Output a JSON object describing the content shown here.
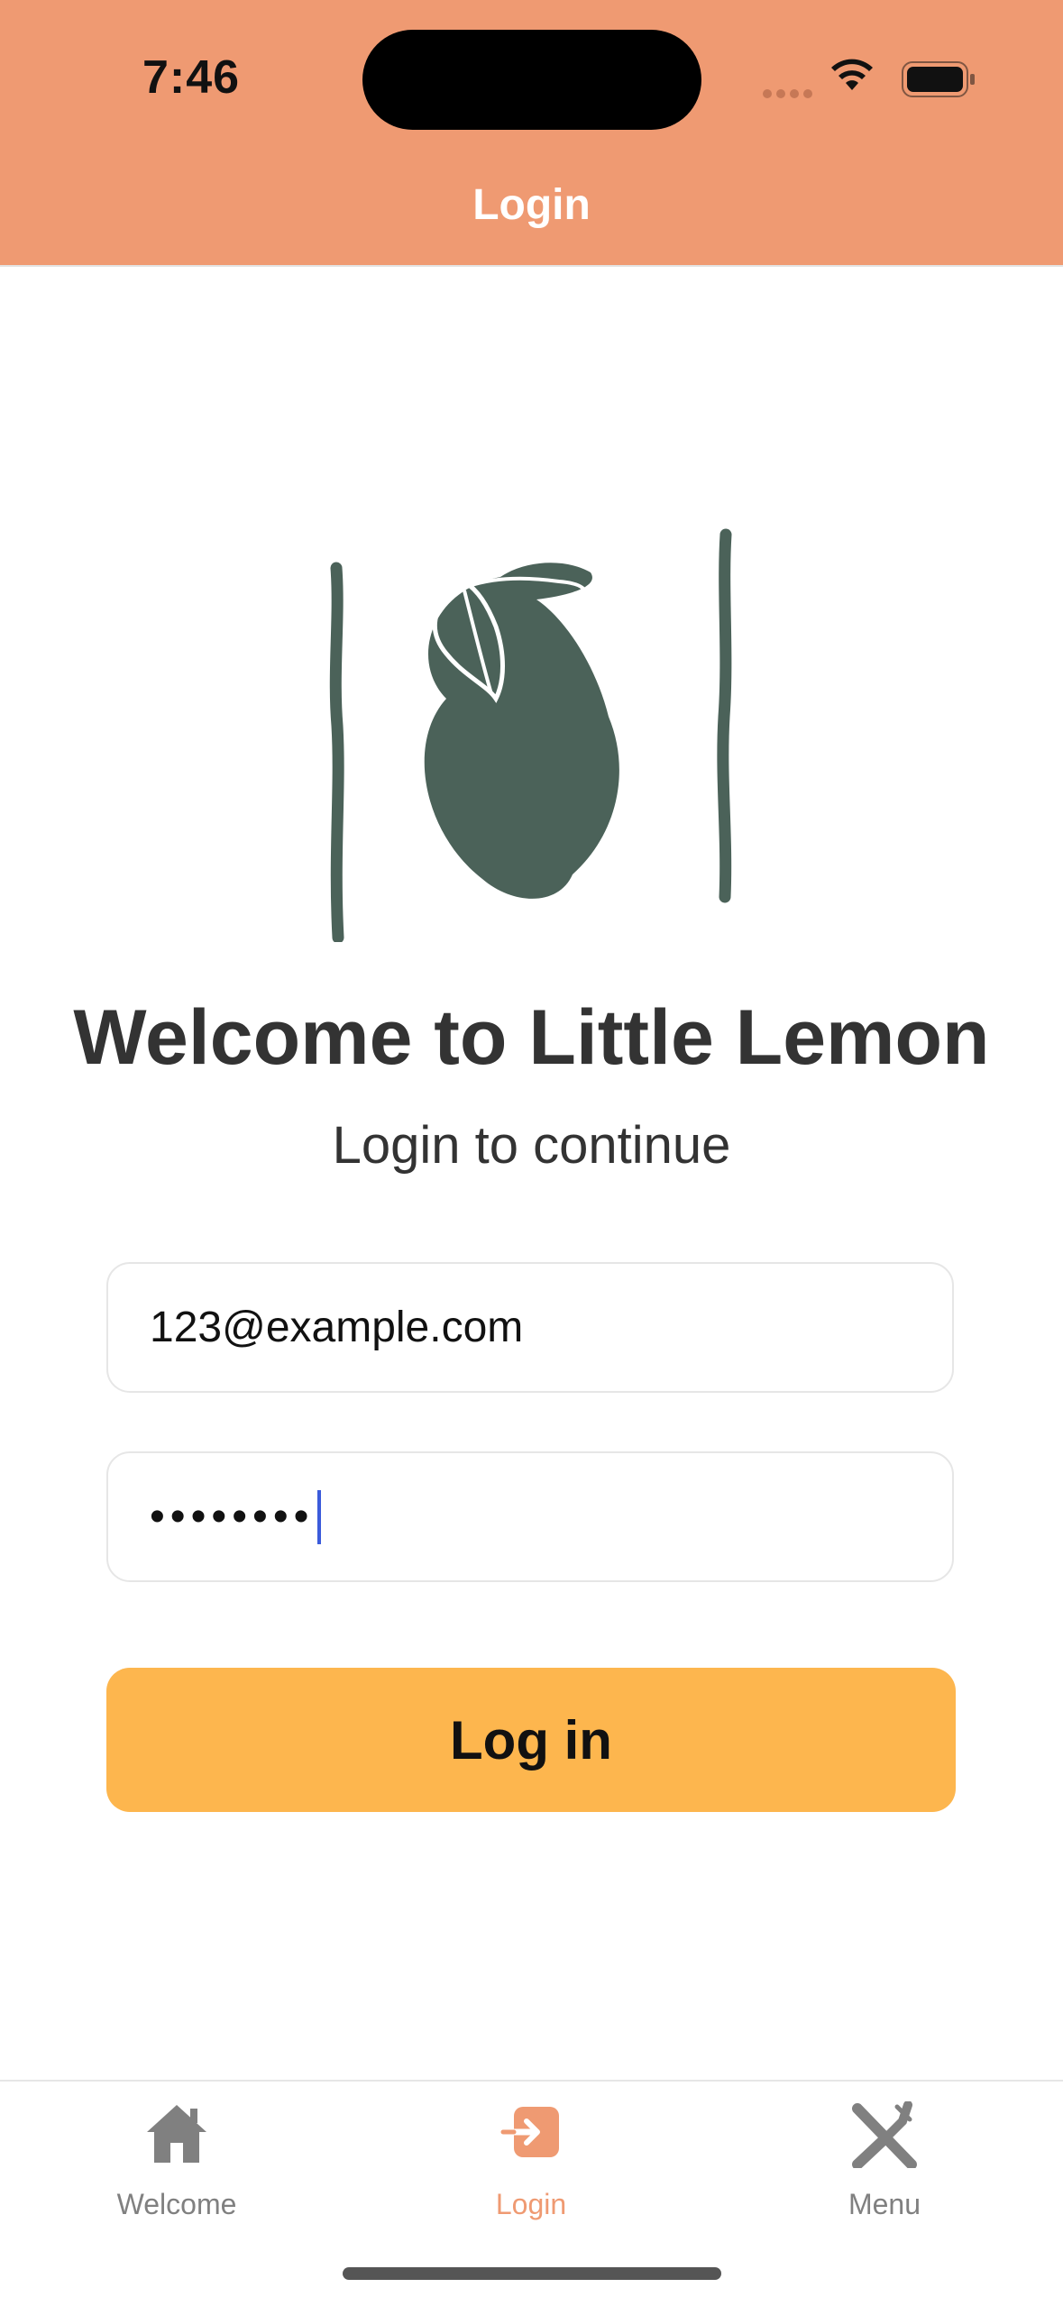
{
  "status_bar": {
    "time": "7:46"
  },
  "header": {
    "title": "Login",
    "background": "#EF9A72"
  },
  "logo": {
    "icon": "lemon-logo-icon",
    "color": "#4B6259"
  },
  "main": {
    "title": "Welcome to Little Lemon",
    "subtitle": "Login to continue"
  },
  "form": {
    "email_value": "123@example.com",
    "password_masked": "••••••••",
    "login_label": "Log in",
    "button_color": "#FDB64E"
  },
  "tabs": [
    {
      "label": "Welcome",
      "icon": "house-icon",
      "active": false
    },
    {
      "label": "Login",
      "icon": "login-arrow-icon",
      "active": true
    },
    {
      "label": "Menu",
      "icon": "fork-knife-icon",
      "active": false
    }
  ]
}
